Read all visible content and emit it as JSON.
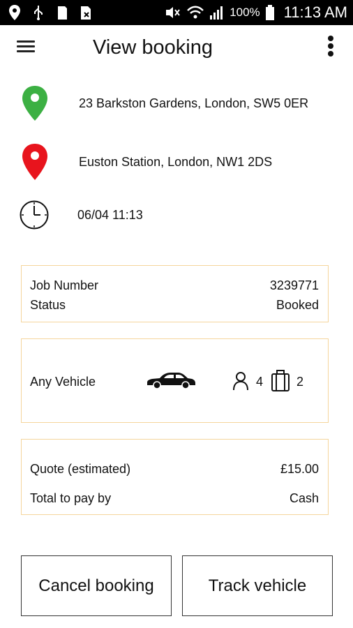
{
  "status_bar": {
    "battery_pct": "100%",
    "time": "11:13 AM",
    "icons": [
      "location-icon",
      "usb-icon",
      "sd-card-icon",
      "sim-icon",
      "mute-icon",
      "wifi-icon",
      "signal-icon",
      "battery-icon"
    ]
  },
  "header": {
    "title": "View booking",
    "menu_icon": "hamburger-menu-icon",
    "overflow_icon": "more-vertical-icon"
  },
  "pickup": {
    "address": "23 Barkston Gardens, London, SW5 0ER",
    "icon": "pickup-pin-icon",
    "color": "#3cb043"
  },
  "dropoff": {
    "address": "Euston Station, London, NW1 2DS",
    "icon": "dropoff-pin-icon",
    "color": "#e8141d"
  },
  "pickup_time": {
    "value": "06/04 11:13",
    "icon": "clock-icon"
  },
  "job_card": {
    "job_number_label": "Job Number",
    "job_number": "3239771",
    "status_label": "Status",
    "status": "Booked"
  },
  "vehicle_card": {
    "vehicle_type": "Any Vehicle",
    "passengers": "4",
    "luggage": "2",
    "icons": [
      "car-icon",
      "passenger-icon",
      "luggage-icon"
    ]
  },
  "price_card": {
    "quote_label": "Quote (estimated)",
    "quote": "£15.00",
    "payment_label": "Total to pay by",
    "payment": "Cash"
  },
  "actions": {
    "cancel_label": "Cancel booking",
    "track_label": "Track vehicle"
  },
  "colors": {
    "card_border": "#f5d59c",
    "status_bar": "#000000"
  }
}
